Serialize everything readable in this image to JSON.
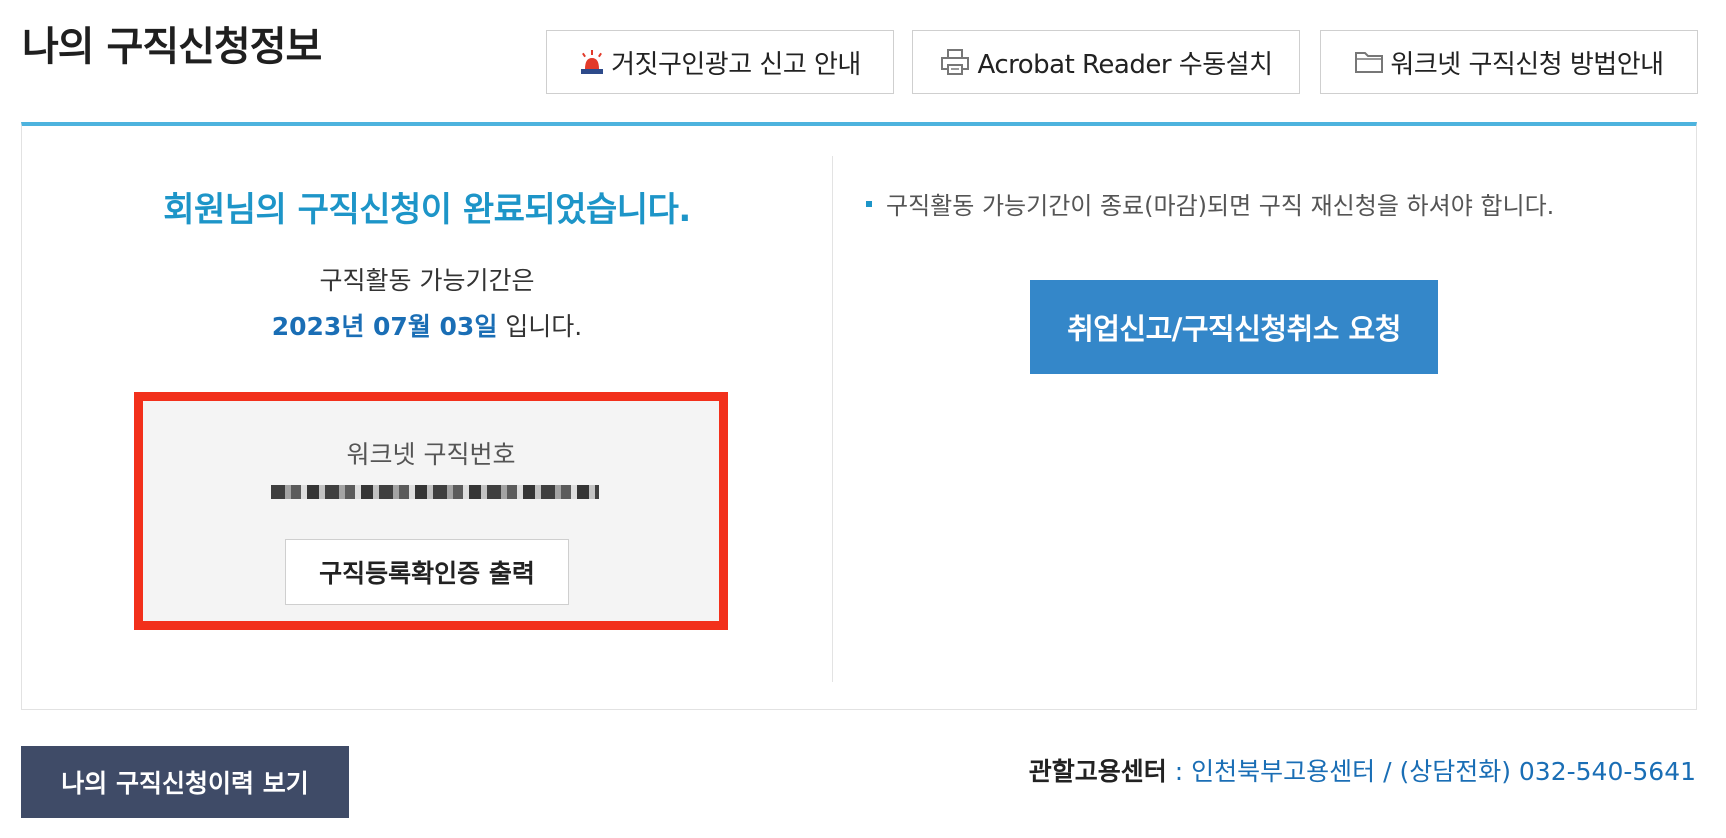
{
  "page": {
    "title": "나의 구직신청정보"
  },
  "top_buttons": {
    "fake_ad": {
      "label": "거짓구인광고 신고 안내",
      "icon": "siren-icon"
    },
    "acrobat": {
      "label": "Acrobat Reader 수동설치",
      "icon": "printer-icon"
    },
    "guide": {
      "label": "워크넷 구직신청 방법안내",
      "icon": "folder-icon"
    }
  },
  "status": {
    "complete_message": "회원님의 구직신청이 완료되었습니다.",
    "period_intro": "구직활동 가능기간은",
    "period_date": "2023년 07월 03일",
    "period_suffix": " 입니다."
  },
  "worknet": {
    "label": "워크넷 구직번호",
    "print_button": "구직등록확인증 출력"
  },
  "notice": {
    "text": "구직활동 가능기간이 종료(마감)되면 구직 재신청을 하셔야 합니다."
  },
  "actions": {
    "cancel_button": "취업신고/구직신청취소 요청",
    "history_button": "나의 구직신청이력 보기"
  },
  "center": {
    "label": "관할고용센터",
    "value": " : 인천북부고용센터 / (상담전화) 032-540-5641"
  },
  "colors": {
    "accent_blue": "#1d95c8",
    "date_blue": "#1a6eb5",
    "highlight_red": "#f2301b",
    "cancel_button": "#3487c9",
    "history_button": "#3f4b67"
  }
}
